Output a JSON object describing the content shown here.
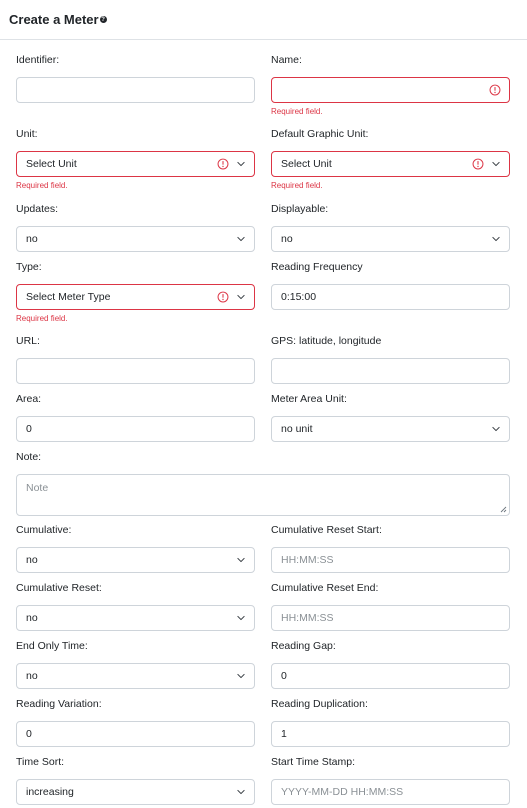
{
  "header": {
    "title": "Create a Meter",
    "help_glyph": "?"
  },
  "fields": {
    "identifier": {
      "label": "Identifier:",
      "value": ""
    },
    "name": {
      "label": "Name:",
      "value": "",
      "error": "Required field."
    },
    "unit": {
      "label": "Unit:",
      "value": "Select Unit",
      "error": "Required field."
    },
    "default_graphic_unit": {
      "label": "Default Graphic Unit:",
      "value": "Select Unit",
      "error": "Required field."
    },
    "updates": {
      "label": "Updates:",
      "value": "no"
    },
    "displayable": {
      "label": "Displayable:",
      "value": "no"
    },
    "type": {
      "label": "Type:",
      "value": "Select Meter Type",
      "error": "Required field."
    },
    "reading_frequency": {
      "label": "Reading Frequency",
      "value": "0:15:00"
    },
    "url": {
      "label": "URL:",
      "value": ""
    },
    "gps": {
      "label": "GPS: latitude, longitude",
      "value": ""
    },
    "area": {
      "label": "Area:",
      "value": "0"
    },
    "meter_area_unit": {
      "label": "Meter Area Unit:",
      "value": "no unit"
    },
    "note": {
      "label": "Note:",
      "placeholder": "Note"
    },
    "cumulative": {
      "label": "Cumulative:",
      "value": "no"
    },
    "cumulative_reset_start": {
      "label": "Cumulative Reset Start:",
      "placeholder": "HH:MM:SS"
    },
    "cumulative_reset": {
      "label": "Cumulative Reset:",
      "value": "no"
    },
    "cumulative_reset_end": {
      "label": "Cumulative Reset End:",
      "placeholder": "HH:MM:SS"
    },
    "end_only_time": {
      "label": "End Only Time:",
      "value": "no"
    },
    "reading_gap": {
      "label": "Reading Gap:",
      "value": "0"
    },
    "reading_variation": {
      "label": "Reading Variation:",
      "value": "0"
    },
    "reading_duplication": {
      "label": "Reading Duplication:",
      "value": "1"
    },
    "time_sort": {
      "label": "Time Sort:",
      "value": "increasing"
    },
    "start_time_stamp": {
      "label": "Start Time Stamp:",
      "placeholder": "YYYY-MM-DD HH:MM:SS"
    }
  },
  "colors": {
    "error": "#dc3545",
    "border": "#ced4da",
    "text": "#212529",
    "placeholder": "#8a9095"
  }
}
